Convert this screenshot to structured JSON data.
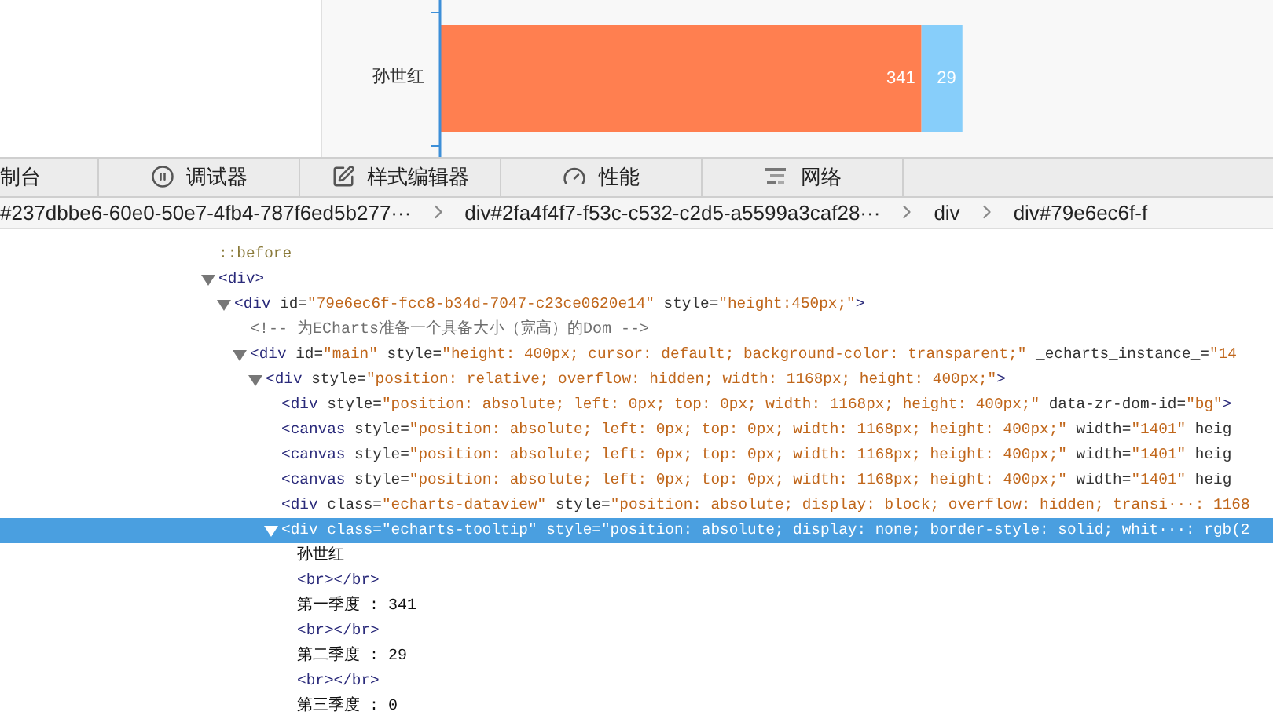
{
  "chart": {
    "chart_data": {
      "type": "bar",
      "orientation": "horizontal",
      "stacked": true,
      "categories": [
        "孙世红"
      ],
      "xlim": [
        0,
        590
      ],
      "data_labels": true,
      "series": [
        {
          "color": "#ff7f50",
          "values": [
            341
          ]
        },
        {
          "color": "#87cefa",
          "values": [
            29
          ]
        }
      ]
    }
  },
  "toolbar": {
    "tabs": [
      {
        "kind": "console",
        "label": "制台",
        "selected": false
      },
      {
        "kind": "debugger",
        "label": "调试器",
        "selected": false
      },
      {
        "kind": "style-editor",
        "label": "样式编辑器",
        "selected": false
      },
      {
        "kind": "performance",
        "label": "性能",
        "selected": false
      },
      {
        "kind": "network",
        "label": "网络",
        "selected": false
      }
    ]
  },
  "breadcrumbs": [
    "#237dbbe6-60e0-50e7-4fb4-787f6ed5b277···",
    "div#2fa4f4f7-f53c-c532-c2d5-a5599a3caf28···",
    "div",
    "div#79e6ec6f-f"
  ],
  "tree": [
    {
      "parts": [
        {
          "kind": "pseudo",
          "text": "::before"
        }
      ],
      "expanded": false,
      "selected": false
    },
    {
      "parts": [
        {
          "kind": "tag",
          "text": "<div>"
        }
      ],
      "expanded": true,
      "selected": false,
      "children": [
        {
          "parts": [
            {
              "kind": "tag",
              "text": "<div"
            },
            {
              "kind": "attr",
              "text": " id="
            },
            {
              "kind": "value",
              "text": "\"79e6ec6f-fcc8-b34d-7047-c23ce0620e14\""
            },
            {
              "kind": "attr",
              "text": " style="
            },
            {
              "kind": "value",
              "text": "\"height:450px;\""
            },
            {
              "kind": "tag",
              "text": ">"
            }
          ],
          "expanded": true,
          "selected": false,
          "children": [
            {
              "parts": [
                {
                  "kind": "comment",
                  "text": "<!-- 为ECharts准备一个具备大小（宽高）的Dom -->"
                }
              ],
              "expanded": false,
              "selected": false
            },
            {
              "parts": [
                {
                  "kind": "tag",
                  "text": "<div"
                },
                {
                  "kind": "attr",
                  "text": " id="
                },
                {
                  "kind": "value",
                  "text": "\"main\""
                },
                {
                  "kind": "attr",
                  "text": " style="
                },
                {
                  "kind": "value",
                  "text": "\"height: 400px; cursor: default; background-color: transparent;\""
                },
                {
                  "kind": "attr",
                  "text": " _echarts_instance_="
                },
                {
                  "kind": "value",
                  "text": "\"14"
                }
              ],
              "expanded": true,
              "selected": false,
              "children": [
                {
                  "parts": [
                    {
                      "kind": "tag",
                      "text": "<div"
                    },
                    {
                      "kind": "attr",
                      "text": " style="
                    },
                    {
                      "kind": "value",
                      "text": "\"position: relative; overflow: hidden; width: 1168px; height: 400px;\""
                    },
                    {
                      "kind": "tag",
                      "text": ">"
                    }
                  ],
                  "expanded": true,
                  "selected": false,
                  "children": [
                    {
                      "parts": [
                        {
                          "kind": "tag",
                          "text": "<div"
                        },
                        {
                          "kind": "attr",
                          "text": " style="
                        },
                        {
                          "kind": "value",
                          "text": "\"position: absolute; left: 0px; top: 0px; width: 1168px; height: 400px;\""
                        },
                        {
                          "kind": "attr",
                          "text": " data-zr-dom-id="
                        },
                        {
                          "kind": "value",
                          "text": "\"bg\""
                        },
                        {
                          "kind": "tag",
                          "text": ">"
                        }
                      ],
                      "expanded": false,
                      "selected": false
                    },
                    {
                      "parts": [
                        {
                          "kind": "tag",
                          "text": "<canvas"
                        },
                        {
                          "kind": "attr",
                          "text": " style="
                        },
                        {
                          "kind": "value",
                          "text": "\"position: absolute; left: 0px; top: 0px; width: 1168px; height: 400px;\""
                        },
                        {
                          "kind": "attr",
                          "text": " width="
                        },
                        {
                          "kind": "value",
                          "text": "\"1401\""
                        },
                        {
                          "kind": "attr",
                          "text": " heig"
                        }
                      ],
                      "expanded": false,
                      "selected": false
                    },
                    {
                      "parts": [
                        {
                          "kind": "tag",
                          "text": "<canvas"
                        },
                        {
                          "kind": "attr",
                          "text": " style="
                        },
                        {
                          "kind": "value",
                          "text": "\"position: absolute; left: 0px; top: 0px; width: 1168px; height: 400px;\""
                        },
                        {
                          "kind": "attr",
                          "text": " width="
                        },
                        {
                          "kind": "value",
                          "text": "\"1401\""
                        },
                        {
                          "kind": "attr",
                          "text": " heig"
                        }
                      ],
                      "expanded": false,
                      "selected": false
                    },
                    {
                      "parts": [
                        {
                          "kind": "tag",
                          "text": "<canvas"
                        },
                        {
                          "kind": "attr",
                          "text": " style="
                        },
                        {
                          "kind": "value",
                          "text": "\"position: absolute; left: 0px; top: 0px; width: 1168px; height: 400px;\""
                        },
                        {
                          "kind": "attr",
                          "text": " width="
                        },
                        {
                          "kind": "value",
                          "text": "\"1401\""
                        },
                        {
                          "kind": "attr",
                          "text": " heig"
                        }
                      ],
                      "expanded": false,
                      "selected": false
                    },
                    {
                      "parts": [
                        {
                          "kind": "tag",
                          "text": "<div"
                        },
                        {
                          "kind": "attr",
                          "text": " class="
                        },
                        {
                          "kind": "value",
                          "text": "\"echarts-dataview\""
                        },
                        {
                          "kind": "attr",
                          "text": " style="
                        },
                        {
                          "kind": "value",
                          "text": "\"position: absolute; display: block; overflow: hidden; transi···: 1168"
                        }
                      ],
                      "expanded": false,
                      "selected": false
                    },
                    {
                      "parts": [
                        {
                          "text": "<div class=\"echarts-tooltip\" style=\"position: absolute; display: none; border-style: solid; whit···: rgb(2"
                        }
                      ],
                      "expanded": true,
                      "selected": true,
                      "children": [
                        {
                          "parts": [
                            {
                              "kind": "text",
                              "text": "孙世红"
                            }
                          ],
                          "expanded": false,
                          "selected": false
                        },
                        {
                          "parts": [
                            {
                              "kind": "tag",
                              "text": "<br></br>"
                            }
                          ],
                          "expanded": false,
                          "selected": false
                        },
                        {
                          "parts": [
                            {
                              "kind": "text",
                              "text": "第一季度 : 341"
                            }
                          ],
                          "expanded": false,
                          "selected": false
                        },
                        {
                          "parts": [
                            {
                              "kind": "tag",
                              "text": "<br></br>"
                            }
                          ],
                          "expanded": false,
                          "selected": false
                        },
                        {
                          "parts": [
                            {
                              "kind": "text",
                              "text": "第二季度 : 29"
                            }
                          ],
                          "expanded": false,
                          "selected": false
                        },
                        {
                          "parts": [
                            {
                              "kind": "tag",
                              "text": "<br></br>"
                            }
                          ],
                          "expanded": false,
                          "selected": false
                        },
                        {
                          "parts": [
                            {
                              "kind": "text",
                              "text": "第三季度 : 0"
                            }
                          ],
                          "expanded": false,
                          "selected": false
                        }
                      ]
                    }
                  ]
                }
              ]
            }
          ]
        }
      ]
    }
  ]
}
